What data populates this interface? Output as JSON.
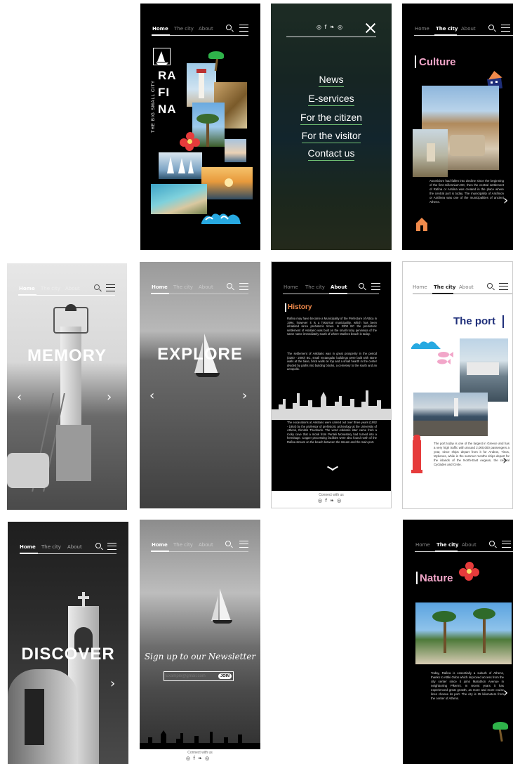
{
  "nav": {
    "home": "Home",
    "city": "The city",
    "about": "About"
  },
  "social_icons": "◎ f ❧ ◎",
  "icons": [
    "search-icon",
    "menu-icon",
    "close-icon",
    "chevron-left-icon",
    "chevron-right-icon",
    "chevron-down-icon"
  ],
  "colors": {
    "black": "#000000",
    "pink": "#f2a6c9",
    "orange": "#f08a4b",
    "navy": "#1f2f7a",
    "cyan": "#27a9e1",
    "red": "#e63b3b",
    "green": "#6fbf73",
    "brand": "#f28b3c"
  },
  "cover": {
    "tagline": "THE BIG SMALL CITY",
    "logo_text": "RA\nFI\nNA"
  },
  "menu": {
    "items": [
      "News",
      "E-services",
      "For the citizen",
      "For the visitor",
      "Contact us"
    ]
  },
  "culture": {
    "title": "Culture",
    "text": "Asceticism had fallen into decline since the beginning of the first millennium BC, then the central settlement of Rafina or Arafina was created in the place where the central port is today. The municipality of Arafinion or Arafinea was one of the municipalities of ancient Athens."
  },
  "memory": {
    "title": "MEMORY"
  },
  "explore": {
    "title": "EXPLORE"
  },
  "history": {
    "title": "History",
    "p1": "Rafina may have become a Municipality of the Prefecture of Attica in 1994, however it is a historical municipality, which has been inhabited since prehistoric times. In 3200 BC the prehistoric settlement of Askitario was built on the small rocky peninsula of the same name immediately south of where Marikes beach is today.",
    "p2": "The settlement of Askitario was in great prosperity in the period (3200 - 2000) BC, small rectangular buildings were built with stone walls at the base, brick walls on top and a small hearth in the center divided by paths into building blocks, a cemetery to the south and an acropolis.",
    "p3": "The excavations at Askitario were carried out over three years (1952 - 1954) by the professor of prehistoric archeology at the University of Athens, Dimitris Theoharis. The word Askitario later came from a rocky cave that a monk from Penteli Monastery had turned into a hermitage. Copper processing facilities were also found north of the Rafina stream on the beach between the stream and the main port.",
    "connect": "Connect with us"
  },
  "port": {
    "title": "The port",
    "text": "The port today is one of the largest in Greece and has a very high traffic with around 2,000,000 passengers a year, since ships depart from it for Andros, Tinos, Mykonos, while in the summer months ships depart for the islands of the North-East Aegean, the central Cyclades and Crete."
  },
  "discover": {
    "title": "DISCOVER"
  },
  "newsletter": {
    "heading": "Sign up to our Newsletter",
    "placeholder": "Example@gmail.com",
    "join": "JOIN",
    "connect": "Connect with us"
  },
  "nature": {
    "title": "Nature",
    "text": "Today, Rafina is essentially a suburb of Athens, thanks to Attiki Odos which improved access from the city center since it joins Marathon Avenue in neighboring Pikermi. In recent years it has experienced great growth, as more and more cruise lines choose its port. The city is 25 kilometers from the center of Athens."
  }
}
